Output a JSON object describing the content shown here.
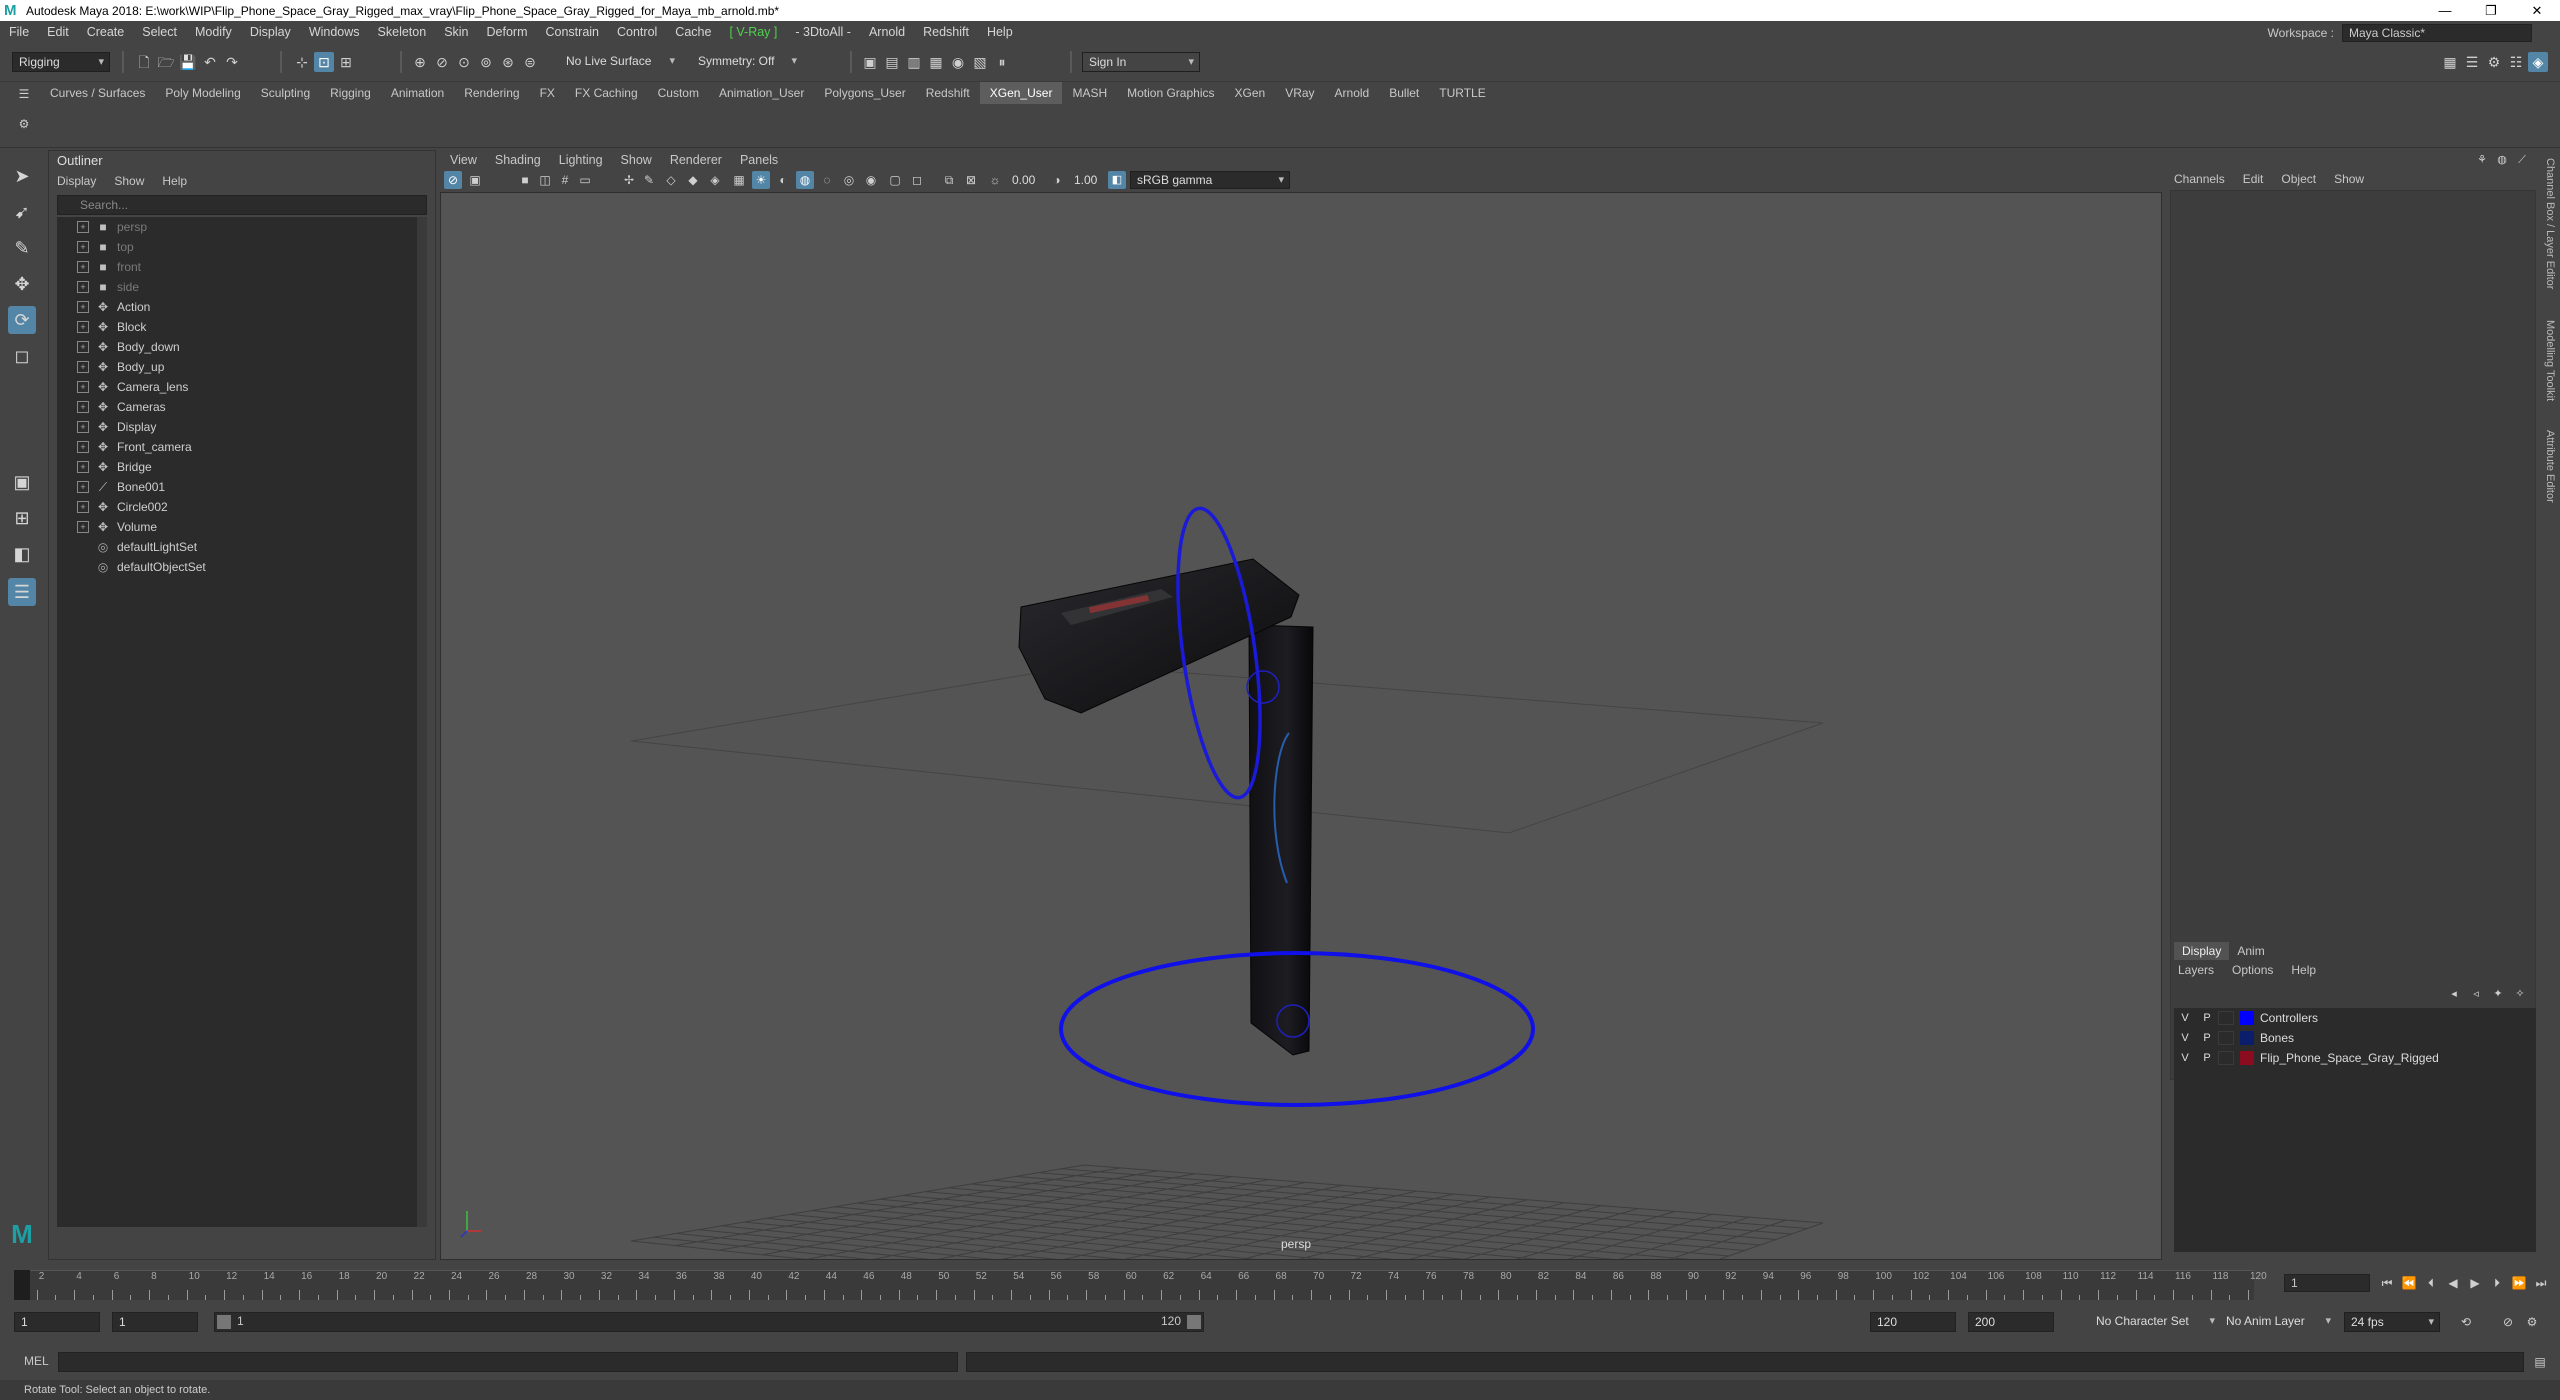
{
  "window": {
    "title": "Autodesk Maya 2018: E:\\work\\WIP\\Flip_Phone_Space_Gray_Rigged_max_vray\\Flip_Phone_Space_Gray_Rigged_for_Maya_mb_arnold.mb*",
    "minimize": "—",
    "maximize": "❐",
    "close": "✕"
  },
  "menubar": [
    "File",
    "Edit",
    "Create",
    "Select",
    "Modify",
    "Display",
    "Windows",
    "Skeleton",
    "Skin",
    "Deform",
    "Constrain",
    "Control",
    "Cache",
    "V-Ray",
    "3DtoAll",
    "Arnold",
    "Redshift",
    "Help"
  ],
  "menubar_vray": "[ V-Ray ]",
  "menubar_3dtoall": "- 3DtoAll -",
  "workspace": {
    "label": "Workspace :",
    "value": "Maya Classic*"
  },
  "statusline": {
    "mode": "Rigging",
    "live_surface": "No Live Surface",
    "symmetry": "Symmetry: Off",
    "sign_in": "Sign In"
  },
  "shelf_tabs": [
    "Curves / Surfaces",
    "Poly Modeling",
    "Sculpting",
    "Rigging",
    "Animation",
    "Rendering",
    "FX",
    "FX Caching",
    "Custom",
    "Animation_User",
    "Polygons_User",
    "Redshift",
    "XGen_User",
    "MASH",
    "Motion Graphics",
    "XGen",
    "VRay",
    "Arnold",
    "Bullet",
    "TURTLE"
  ],
  "shelf_active": "XGen_User",
  "outliner": {
    "title": "Outliner",
    "menu": [
      "Display",
      "Show",
      "Help"
    ],
    "search_placeholder": "Search...",
    "items": [
      {
        "name": "persp",
        "kind": "camera"
      },
      {
        "name": "top",
        "kind": "camera"
      },
      {
        "name": "front",
        "kind": "camera"
      },
      {
        "name": "side",
        "kind": "camera"
      },
      {
        "name": "Action",
        "kind": "transform"
      },
      {
        "name": "Block",
        "kind": "transform"
      },
      {
        "name": "Body_down",
        "kind": "transform"
      },
      {
        "name": "Body_up",
        "kind": "transform"
      },
      {
        "name": "Camera_lens",
        "kind": "transform"
      },
      {
        "name": "Cameras",
        "kind": "transform"
      },
      {
        "name": "Display",
        "kind": "transform"
      },
      {
        "name": "Front_camera",
        "kind": "transform"
      },
      {
        "name": "Bridge",
        "kind": "transform"
      },
      {
        "name": "Bone001",
        "kind": "joint"
      },
      {
        "name": "Circle002",
        "kind": "transform"
      },
      {
        "name": "Volume",
        "kind": "transform"
      },
      {
        "name": "defaultLightSet",
        "kind": "set"
      },
      {
        "name": "defaultObjectSet",
        "kind": "set"
      }
    ]
  },
  "viewport": {
    "menu": [
      "View",
      "Shading",
      "Lighting",
      "Show",
      "Renderer",
      "Panels"
    ],
    "exposure": "0.00",
    "gamma": "1.00",
    "color_space": "sRGB gamma",
    "camera_label": "persp"
  },
  "channel_box": {
    "menu": [
      "Channels",
      "Edit",
      "Object",
      "Show"
    ]
  },
  "layer_editor": {
    "tabs": [
      "Display",
      "Anim"
    ],
    "menu": [
      "Layers",
      "Options",
      "Help"
    ],
    "layers": [
      {
        "v": "V",
        "p": "P",
        "name": "Controllers",
        "color": "#0000ff"
      },
      {
        "v": "V",
        "p": "P",
        "name": "Bones",
        "color": "#0b1e6b"
      },
      {
        "v": "V",
        "p": "P",
        "name": "Flip_Phone_Space_Gray_Rigged",
        "color": "#8a0c1e"
      }
    ]
  },
  "side_tabs": [
    "Channel Box / Layer Editor",
    "Modelling Toolkit",
    "Attribute Editor"
  ],
  "timeline": {
    "ticks": [
      "1",
      "2",
      "4",
      "6",
      "8",
      "10",
      "12",
      "14",
      "16",
      "18",
      "20",
      "22",
      "24",
      "26",
      "28",
      "30",
      "32",
      "34",
      "36",
      "38",
      "40",
      "42",
      "44",
      "46",
      "48",
      "50",
      "52",
      "54",
      "56",
      "58",
      "60",
      "62",
      "64",
      "66",
      "68",
      "70",
      "72",
      "74",
      "76",
      "78",
      "80",
      "82",
      "84",
      "86",
      "88",
      "90",
      "92",
      "94",
      "96",
      "98",
      "100",
      "102",
      "104",
      "106",
      "108",
      "110",
      "112",
      "114",
      "116",
      "118",
      "120"
    ],
    "current_frame": "1"
  },
  "range": {
    "start": "1",
    "playback_start": "1",
    "slider_start": "1",
    "slider_end": "120",
    "playback_end": "120",
    "end": "200",
    "character_set": "No Character Set",
    "anim_layer": "No Anim Layer",
    "fps": "24 fps"
  },
  "cmdline": {
    "label": "MEL"
  },
  "helpline": "Rotate Tool: Select an object to rotate."
}
